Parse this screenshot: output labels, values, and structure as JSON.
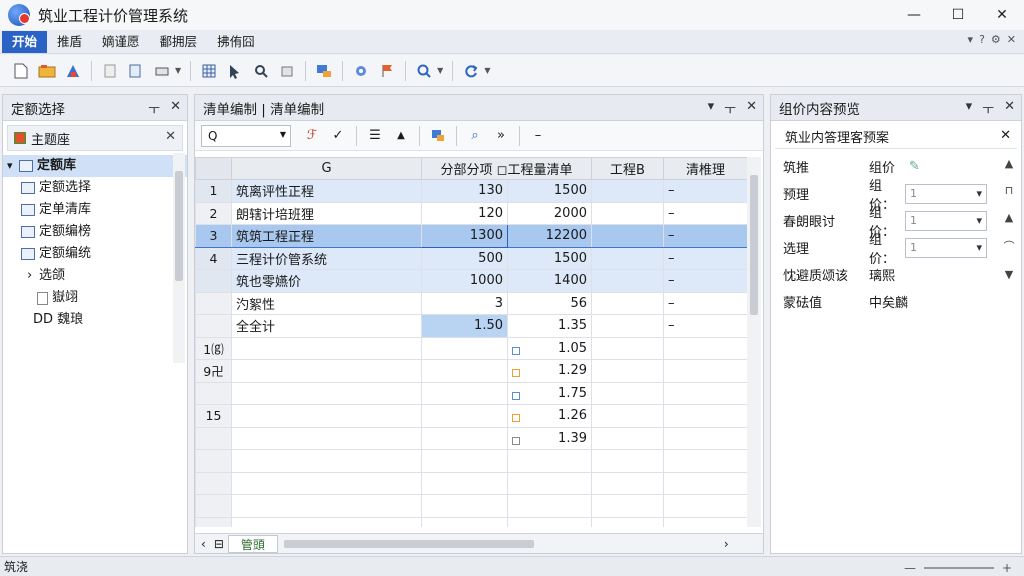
{
  "window": {
    "title": "筑业工程计价管理系统",
    "controls": [
      "—",
      "☐",
      "✕"
    ]
  },
  "menu": {
    "items": [
      "开始",
      "推盾",
      "嫡谨愿",
      "鄱拥层",
      "拂侑囧"
    ],
    "active_index": 0,
    "right_icons": [
      "▾",
      "?",
      "⚙",
      "✕"
    ]
  },
  "toolbar": {
    "groups": [
      [
        "new-doc-icon",
        "open-folder-icon",
        "save-icon"
      ],
      [
        "paste-icon",
        "copy-icon",
        "print-icon"
      ],
      [
        "grid-icon",
        "cursor-icon",
        "zoom-tool-icon",
        "table-icon"
      ],
      [
        "paint-icon"
      ],
      [
        "settings-icon",
        "flag-icon"
      ],
      [
        "search-icon"
      ],
      [
        "refresh-icon"
      ]
    ]
  },
  "left_panel": {
    "title": "定额选择",
    "head_btns": [
      "ㅜ",
      "✕"
    ],
    "sub_title": "主题座",
    "tree": [
      {
        "label": "定额库",
        "level": 0,
        "selected": true,
        "expander": "▾"
      },
      {
        "label": "定额选择",
        "level": 1
      },
      {
        "label": "定单清库",
        "level": 1
      },
      {
        "label": "定额编榜",
        "level": 1
      },
      {
        "label": "定额编统",
        "level": 1
      },
      {
        "label": "选颌",
        "level": 1,
        "expander": "›"
      },
      {
        "label": "嶽翊",
        "level": 2
      },
      {
        "label": "DD 魏琅",
        "level": 1
      }
    ]
  },
  "mid_panel": {
    "title": "清单编制 | 清单编制",
    "head_btns": [
      "▾",
      "ㅜ",
      "✕"
    ],
    "search_placeholder": "Q",
    "columns": [
      "",
      "G",
      "分部分项 ◻工程量清单",
      "",
      "工程B",
      "清椎理"
    ],
    "rows": [
      {
        "rn": "1",
        "name": "筑离评性正程",
        "c1": "130",
        "c2": "1500",
        "c4": "–",
        "style": "hl"
      },
      {
        "rn": "2",
        "name": "朗辖计培班狸",
        "c1": "120",
        "c2": "2000",
        "c4": "–",
        "style": ""
      },
      {
        "rn": "3",
        "name": "筑筑工程正程",
        "c1": "1300",
        "c2": "12200",
        "c4": "–",
        "style": "sel"
      },
      {
        "rn": "4",
        "name": "三程计价管系统",
        "c1": "500",
        "c2": "1500",
        "c4": "–",
        "style": "hl"
      },
      {
        "rn": "",
        "name": "筑也零嬿价",
        "c1": "1000",
        "c2": "1400",
        "c4": "–",
        "style": "hl"
      },
      {
        "rn": "",
        "name": "汋絮性",
        "c1": "3",
        "c2": "56",
        "c4": "–",
        "style": ""
      },
      {
        "rn": "",
        "name": "全全计",
        "c1": "1.50",
        "c2": "1.35",
        "c4": "–",
        "style": ""
      },
      {
        "rn": "1⒢",
        "name": "",
        "c1": "",
        "c2": "1.05",
        "c4": "",
        "style": ""
      },
      {
        "rn": "9卍",
        "name": "",
        "c1": "",
        "c2": "1.29",
        "c4": "",
        "style": ""
      },
      {
        "rn": "",
        "name": "",
        "c1": "",
        "c2": "1.75",
        "c4": "",
        "style": ""
      },
      {
        "rn": "15",
        "name": "",
        "c1": "",
        "c2": "1.26",
        "c4": "",
        "style": ""
      },
      {
        "rn": "",
        "name": "",
        "c1": "",
        "c2": "1.39",
        "c4": "",
        "style": ""
      },
      {
        "rn": "",
        "name": "",
        "c1": "",
        "c2": "",
        "c4": "",
        "style": ""
      },
      {
        "rn": "",
        "name": "",
        "c1": "",
        "c2": "",
        "c4": "",
        "style": ""
      },
      {
        "rn": "",
        "name": "",
        "c1": "",
        "c2": "",
        "c4": "",
        "style": ""
      },
      {
        "rn": "",
        "name": "",
        "c1": "",
        "c2": "",
        "c4": "",
        "style": ""
      }
    ],
    "sheet_tab": "管頭"
  },
  "right_panel": {
    "title": "组价内容预览",
    "head_btns": [
      "▾",
      "ㅜ",
      "✕"
    ],
    "sub_title": "筑业内答理客预案",
    "rows": [
      {
        "k": "筑推",
        "g": "组价",
        "v": ""
      },
      {
        "k": "预理",
        "g": "组价：",
        "v": "1"
      },
      {
        "k": "春朗眼讨",
        "g": "组价：",
        "v": "1"
      },
      {
        "k": "选理",
        "g": "组价：",
        "v": "1"
      },
      {
        "k": "忱避质颂该",
        "g": "璃熙",
        "v": ""
      },
      {
        "k": "蒙砝值",
        "g": "中矣麟",
        "v": ""
      }
    ]
  },
  "status": {
    "text": "筑浇"
  }
}
